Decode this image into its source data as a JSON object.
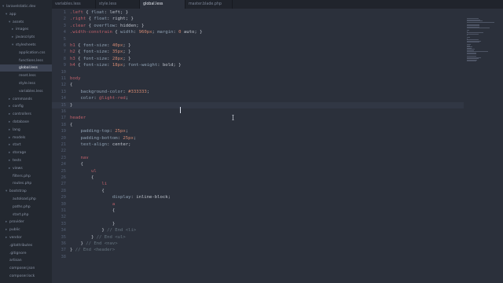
{
  "app": {
    "tabs": [
      {
        "label": "variables.less"
      },
      {
        "label": "style.less"
      },
      {
        "label": "global.less"
      },
      {
        "label": "master.blade.php"
      }
    ],
    "active_tab_index": 2
  },
  "sidebar": {
    "items": [
      {
        "label": "laravelstatic.dev",
        "level": 0,
        "open": true
      },
      {
        "label": "app",
        "level": 1,
        "open": true
      },
      {
        "label": "assets",
        "level": 2,
        "open": true
      },
      {
        "label": "images",
        "level": 3,
        "open": false
      },
      {
        "label": "javascripts",
        "level": 3,
        "open": false
      },
      {
        "label": "stylesheets",
        "level": 3,
        "open": true
      },
      {
        "label": "application.css",
        "level": 4
      },
      {
        "label": "functions.less",
        "level": 4
      },
      {
        "label": "global.less",
        "level": 4,
        "active": true
      },
      {
        "label": "reset.less",
        "level": 4
      },
      {
        "label": "style.less",
        "level": 4
      },
      {
        "label": "variables.less",
        "level": 4
      },
      {
        "label": "commands",
        "level": 2,
        "open": false
      },
      {
        "label": "config",
        "level": 2,
        "open": false
      },
      {
        "label": "controllers",
        "level": 2,
        "open": false
      },
      {
        "label": "database",
        "level": 2,
        "open": false
      },
      {
        "label": "lang",
        "level": 2,
        "open": false
      },
      {
        "label": "models",
        "level": 2,
        "open": false
      },
      {
        "label": "start",
        "level": 2,
        "open": false
      },
      {
        "label": "storage",
        "level": 2,
        "open": false
      },
      {
        "label": "tests",
        "level": 2,
        "open": false
      },
      {
        "label": "views",
        "level": 2,
        "open": false
      },
      {
        "label": "filters.php",
        "level": 2
      },
      {
        "label": "routes.php",
        "level": 2
      },
      {
        "label": "bootstrap",
        "level": 1,
        "open": true
      },
      {
        "label": "autoload.php",
        "level": 2
      },
      {
        "label": "paths.php",
        "level": 2
      },
      {
        "label": "start.php",
        "level": 2
      },
      {
        "label": "provider",
        "level": 1,
        "open": false
      },
      {
        "label": "public",
        "level": 1,
        "open": false
      },
      {
        "label": "vendor",
        "level": 1,
        "open": false
      },
      {
        "label": ".gitattributes",
        "level": 1
      },
      {
        "label": ".gitignore",
        "level": 1
      },
      {
        "label": "artisan",
        "level": 1
      },
      {
        "label": "composer.json",
        "level": 1
      },
      {
        "label": "composer.lock",
        "level": 1
      }
    ]
  },
  "editor": {
    "current_line": 15,
    "lines": [
      {
        "n": "1",
        "tokens": [
          {
            "t": ".left",
            "c": "sel"
          },
          {
            "t": " { "
          },
          {
            "t": "float",
            "c": "prop"
          },
          {
            "t": ": left; }"
          }
        ]
      },
      {
        "n": "2",
        "tokens": [
          {
            "t": ".right",
            "c": "sel"
          },
          {
            "t": " { "
          },
          {
            "t": "float",
            "c": "prop"
          },
          {
            "t": ": right; }"
          }
        ]
      },
      {
        "n": "3",
        "tokens": [
          {
            "t": ".clear",
            "c": "sel"
          },
          {
            "t": " { "
          },
          {
            "t": "overflow",
            "c": "prop"
          },
          {
            "t": ": hidden; }"
          }
        ]
      },
      {
        "n": "4",
        "tokens": [
          {
            "t": ".width-constrain",
            "c": "sel"
          },
          {
            "t": " { "
          },
          {
            "t": "width",
            "c": "prop"
          },
          {
            "t": ": "
          },
          {
            "t": "960px",
            "c": "num"
          },
          {
            "t": "; "
          },
          {
            "t": "margin",
            "c": "prop"
          },
          {
            "t": ": "
          },
          {
            "t": "0",
            "c": "num"
          },
          {
            "t": " auto; }"
          }
        ]
      },
      {
        "n": "5",
        "tokens": []
      },
      {
        "n": "6",
        "tokens": [
          {
            "t": "h1",
            "c": "sel"
          },
          {
            "t": " { "
          },
          {
            "t": "font-size",
            "c": "prop"
          },
          {
            "t": ": "
          },
          {
            "t": "40px",
            "c": "num"
          },
          {
            "t": "; }"
          }
        ]
      },
      {
        "n": "7",
        "tokens": [
          {
            "t": "h2",
            "c": "sel"
          },
          {
            "t": " { "
          },
          {
            "t": "font-size",
            "c": "prop"
          },
          {
            "t": ": "
          },
          {
            "t": "35px",
            "c": "num"
          },
          {
            "t": "; }"
          }
        ]
      },
      {
        "n": "8",
        "tokens": [
          {
            "t": "h3",
            "c": "sel"
          },
          {
            "t": " { "
          },
          {
            "t": "font-size",
            "c": "prop"
          },
          {
            "t": ": "
          },
          {
            "t": "28px",
            "c": "num"
          },
          {
            "t": "; }"
          }
        ]
      },
      {
        "n": "9",
        "tokens": [
          {
            "t": "h4",
            "c": "sel"
          },
          {
            "t": " { "
          },
          {
            "t": "font-size",
            "c": "prop"
          },
          {
            "t": ": "
          },
          {
            "t": "18px",
            "c": "num"
          },
          {
            "t": "; "
          },
          {
            "t": "font-weight",
            "c": "prop"
          },
          {
            "t": ": bold; }"
          }
        ]
      },
      {
        "n": "10",
        "tokens": []
      },
      {
        "n": "11",
        "tokens": [
          {
            "t": "body",
            "c": "sel"
          }
        ]
      },
      {
        "n": "12",
        "tokens": [
          {
            "t": "{"
          }
        ]
      },
      {
        "n": "13",
        "tokens": [
          {
            "t": "    "
          },
          {
            "t": "background-color",
            "c": "prop"
          },
          {
            "t": ": "
          },
          {
            "t": "#333333",
            "c": "num"
          },
          {
            "t": ";"
          }
        ]
      },
      {
        "n": "14",
        "tokens": [
          {
            "t": "    "
          },
          {
            "t": "color",
            "c": "prop"
          },
          {
            "t": ": "
          },
          {
            "t": "@light-red",
            "c": "sel"
          },
          {
            "t": ";"
          }
        ]
      },
      {
        "n": "15",
        "tokens": [
          {
            "t": "}"
          }
        ]
      },
      {
        "n": "16",
        "tokens": []
      },
      {
        "n": "17",
        "tokens": [
          {
            "t": "header",
            "c": "sel"
          }
        ]
      },
      {
        "n": "18",
        "tokens": [
          {
            "t": "{"
          }
        ]
      },
      {
        "n": "19",
        "tokens": [
          {
            "t": "    "
          },
          {
            "t": "padding-top",
            "c": "prop"
          },
          {
            "t": ": "
          },
          {
            "t": "25px",
            "c": "num"
          },
          {
            "t": ";"
          }
        ]
      },
      {
        "n": "20",
        "tokens": [
          {
            "t": "    "
          },
          {
            "t": "padding-bottom",
            "c": "prop"
          },
          {
            "t": ": "
          },
          {
            "t": "25px",
            "c": "num"
          },
          {
            "t": ";"
          }
        ]
      },
      {
        "n": "21",
        "tokens": [
          {
            "t": "    "
          },
          {
            "t": "text-align",
            "c": "prop"
          },
          {
            "t": ": center;"
          }
        ]
      },
      {
        "n": "22",
        "tokens": []
      },
      {
        "n": "23",
        "tokens": [
          {
            "t": "    "
          },
          {
            "t": "nav",
            "c": "sel"
          }
        ]
      },
      {
        "n": "24",
        "tokens": [
          {
            "t": "    {"
          }
        ]
      },
      {
        "n": "25",
        "tokens": [
          {
            "t": "        "
          },
          {
            "t": "ul",
            "c": "sel"
          }
        ]
      },
      {
        "n": "26",
        "tokens": [
          {
            "t": "        {"
          }
        ]
      },
      {
        "n": "27",
        "tokens": [
          {
            "t": "            "
          },
          {
            "t": "li",
            "c": "sel"
          }
        ]
      },
      {
        "n": "28",
        "tokens": [
          {
            "t": "            {"
          }
        ]
      },
      {
        "n": "29",
        "tokens": [
          {
            "t": "                "
          },
          {
            "t": "display",
            "c": "prop"
          },
          {
            "t": ": inline-block;"
          }
        ]
      },
      {
        "n": "30",
        "tokens": [
          {
            "t": "                "
          },
          {
            "t": "a",
            "c": "sel"
          }
        ]
      },
      {
        "n": "31",
        "tokens": [
          {
            "t": "                {"
          }
        ]
      },
      {
        "n": "32",
        "tokens": []
      },
      {
        "n": "33",
        "tokens": [
          {
            "t": "                }"
          }
        ]
      },
      {
        "n": "34",
        "tokens": [
          {
            "t": "            } "
          },
          {
            "t": "// End <li>",
            "c": "cmt"
          }
        ]
      },
      {
        "n": "35",
        "tokens": [
          {
            "t": "        } "
          },
          {
            "t": "// End <ul>",
            "c": "cmt"
          }
        ]
      },
      {
        "n": "36",
        "tokens": [
          {
            "t": "    } "
          },
          {
            "t": "// End <nav>",
            "c": "cmt"
          }
        ]
      },
      {
        "n": "37",
        "tokens": [
          {
            "t": "} "
          },
          {
            "t": "// End <header>",
            "c": "cmt"
          }
        ]
      },
      {
        "n": "38",
        "tokens": []
      }
    ]
  },
  "colors": {
    "background": "#2b303b",
    "sidebar": "#232830",
    "selector": "#bf616a",
    "property": "#8fa1b3",
    "number": "#d08770",
    "comment": "#65737e"
  }
}
